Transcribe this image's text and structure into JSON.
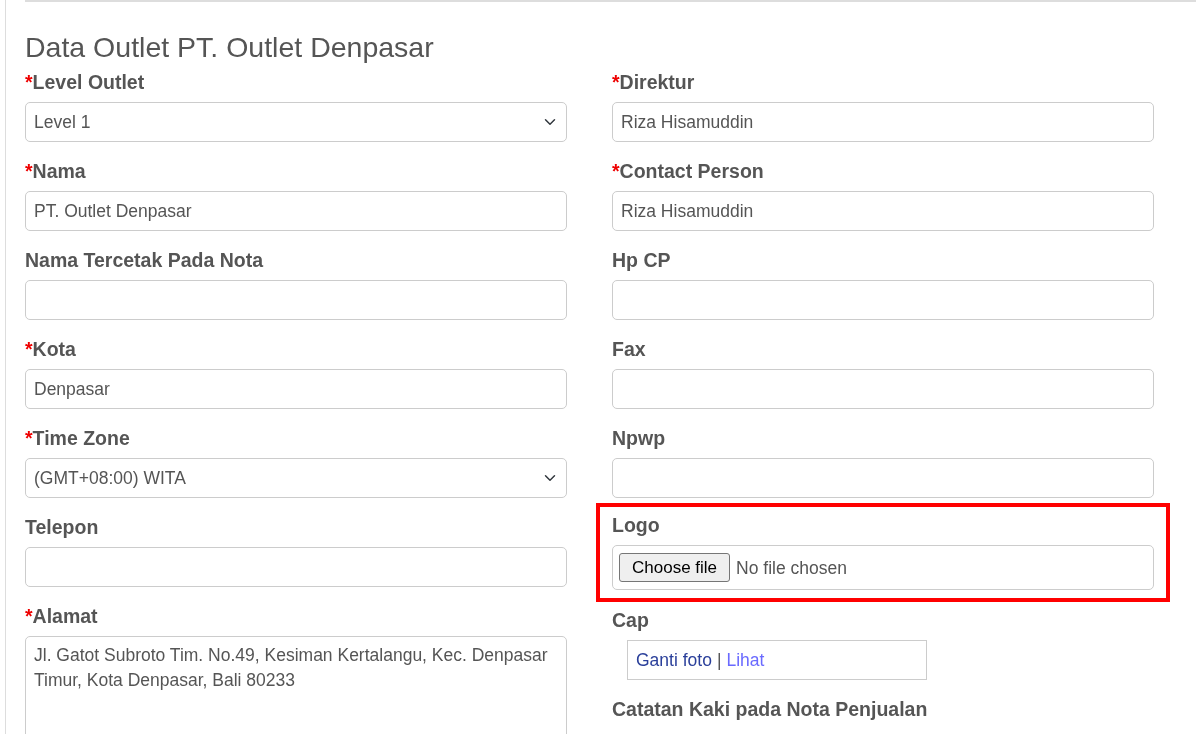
{
  "title": "Data Outlet PT. Outlet Denpasar",
  "required_marker": "*",
  "left_fields": [
    {
      "kind": "select",
      "label": "Level Outlet",
      "required": true,
      "value": "Level 1"
    },
    {
      "kind": "text",
      "label": "Nama",
      "required": true,
      "value": "PT. Outlet Denpasar"
    },
    {
      "kind": "text",
      "label": "Nama Tercetak Pada Nota",
      "required": false
    },
    {
      "kind": "text",
      "label": "Kota",
      "required": true,
      "value": "Denpasar"
    },
    {
      "kind": "select",
      "label": "Time Zone",
      "required": true,
      "value": "(GMT+08:00) WITA"
    },
    {
      "kind": "text",
      "label": "Telepon",
      "required": false
    },
    {
      "kind": "textarea",
      "label": "Alamat",
      "required": true,
      "value": "Jl. Gatot Subroto Tim. No.49, Kesiman Kertalangu, Kec. Denpasar Timur, Kota Denpasar, Bali 80233"
    }
  ],
  "right_fields": [
    {
      "kind": "text",
      "label": "Direktur",
      "required": true,
      "value": "Riza Hisamuddin"
    },
    {
      "kind": "text",
      "label": "Contact Person",
      "required": true,
      "value": "Riza Hisamuddin"
    },
    {
      "kind": "text",
      "label": "Hp CP",
      "required": false
    },
    {
      "kind": "text",
      "label": "Fax",
      "required": false
    },
    {
      "kind": "text",
      "label": "Npwp",
      "required": false
    },
    {
      "kind": "file",
      "label": "Logo",
      "required": false,
      "highlighted": true,
      "button": "Choose file",
      "status": "No file chosen"
    },
    {
      "kind": "links",
      "label": "Cap",
      "required": false,
      "links": [
        "Ganti foto",
        "Lihat"
      ],
      "separator": "|"
    },
    {
      "kind": "heading",
      "label": "Catatan Kaki pada Nota Penjualan",
      "required": false
    }
  ]
}
